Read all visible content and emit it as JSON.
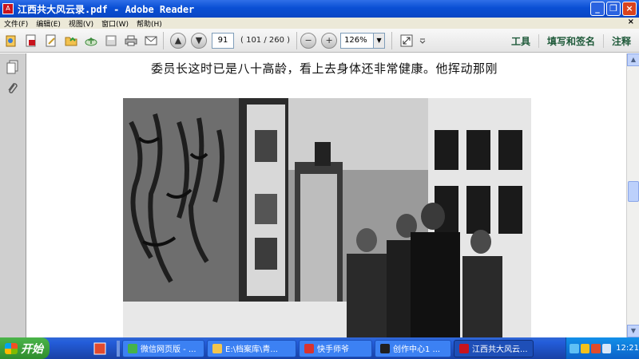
{
  "window": {
    "title": "江西共大风云录.pdf - Adobe Reader"
  },
  "menu": {
    "items": [
      "文件(F)",
      "编辑(E)",
      "视图(V)",
      "窗口(W)",
      "帮助(H)"
    ],
    "close_glyph": "×"
  },
  "toolbar": {
    "page_current": "91",
    "page_total": "( 101 / 260 )",
    "zoom": "126%",
    "right_links": [
      "工具",
      "填写和签名",
      "注释"
    ]
  },
  "document": {
    "text_line": "委员长这时已是八十高龄，看上去身体还非常健康。他挥动那刚"
  },
  "taskbar": {
    "start_label": "开始",
    "tasks": [
      {
        "label": "微信网页版 - ...",
        "color": "#45b34a"
      },
      {
        "label": "E:\\档案库\\青...",
        "color": "#f3c54d"
      },
      {
        "label": "快手师爷",
        "color": "#d8342f"
      },
      {
        "label": "创作中心1 ...",
        "color": "#202020"
      },
      {
        "label": "江西共大风云...",
        "color": "#c8141e"
      }
    ],
    "clock": "12:21"
  }
}
